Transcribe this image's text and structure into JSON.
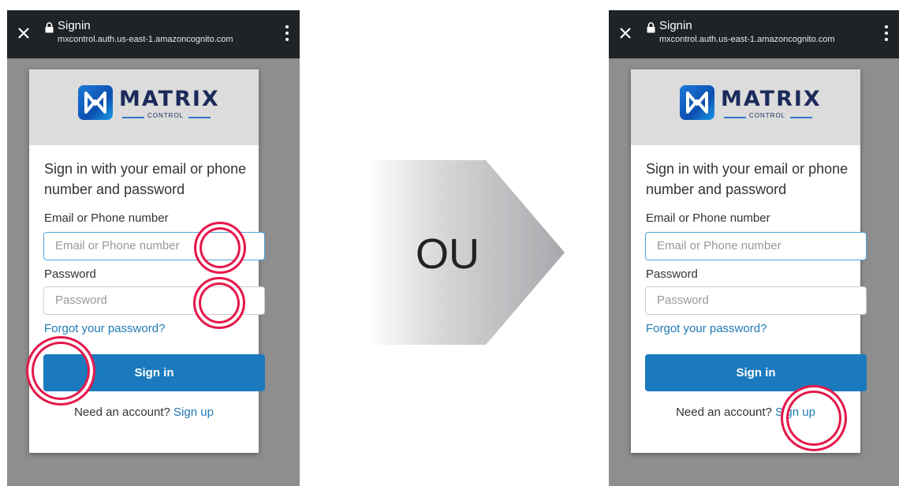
{
  "left_screen": {
    "topbar": {
      "title": "Signin",
      "url": "mxcontrol.auth.us-east-1.amazoncognito.com"
    },
    "logo": {
      "word": "MATRIX",
      "sub": "CONTROL"
    },
    "heading": "Sign in with your email or phone number and password",
    "email_label": "Email or Phone number",
    "email_placeholder": "Email or Phone number",
    "password_label": "Password",
    "password_placeholder": "Password",
    "forgot_link": "Forgot your password?",
    "signin_button": "Sign in",
    "need_account": "Need an account?",
    "signup_link": "Sign up"
  },
  "right_screen": {
    "topbar": {
      "title": "Signin",
      "url": "mxcontrol.auth.us-east-1.amazoncognito.com"
    },
    "logo": {
      "word": "MATRIX",
      "sub": "CONTROL"
    },
    "heading": "Sign in with your email or phone number and password",
    "email_label": "Email or Phone number",
    "email_placeholder": "Email or Phone number",
    "password_label": "Password",
    "password_placeholder": "Password",
    "forgot_link": "Forgot your password?",
    "signin_button": "Sign in",
    "need_account": "Need an account?",
    "signup_link": "Sign up"
  },
  "divider_label": "OU",
  "colors": {
    "highlight": "#e5194b",
    "button": "#1a7abd",
    "link": "#1f7ab5",
    "topbar": "#1f2326"
  },
  "icons": [
    "close-icon",
    "lock-icon",
    "menu-icon",
    "arrow-right-shape"
  ]
}
